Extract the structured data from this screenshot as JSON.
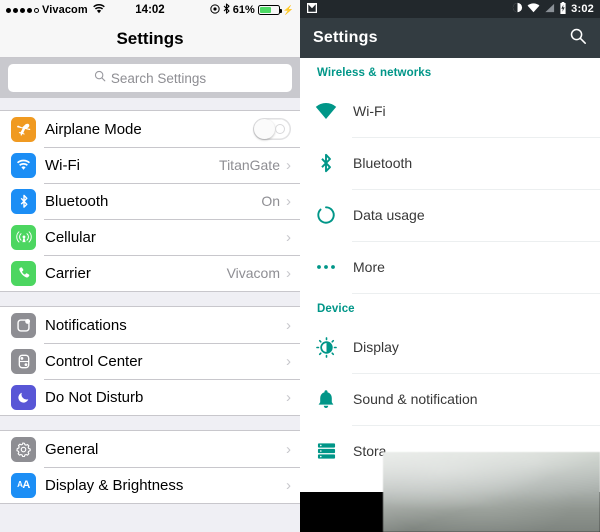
{
  "ios": {
    "status": {
      "carrier": "Vivacom",
      "signal_dots_filled": 4,
      "signal_dots_hollow": 1,
      "wifi_icon": "wifi-icon",
      "time": "14:02",
      "location_icon": "location-icon",
      "bluetooth_icon": "bluetooth-icon",
      "battery_percent": "61%",
      "battery_fill_pct": 61,
      "battery_color": "#4cd964",
      "charging_icon": "charging-bolt-icon"
    },
    "navbar": {
      "title": "Settings"
    },
    "search": {
      "placeholder": "Search Settings",
      "icon": "search-icon"
    },
    "groups": [
      {
        "rows": [
          {
            "label": "Airplane Mode",
            "icon": "airplane-icon",
            "icon_color": "#f09a21",
            "control": "toggle",
            "toggle_on": false
          },
          {
            "label": "Wi-Fi",
            "icon": "wifi-icon",
            "icon_color": "#1c8ef5",
            "value": "TitanGate",
            "control": "chevron"
          },
          {
            "label": "Bluetooth",
            "icon": "bluetooth-icon",
            "icon_color": "#1c8ef5",
            "value": "On",
            "control": "chevron"
          },
          {
            "label": "Cellular",
            "icon": "cellular-icon",
            "icon_color": "#4cd660",
            "value": "",
            "control": "chevron"
          },
          {
            "label": "Carrier",
            "icon": "phone-icon",
            "icon_color": "#4cd660",
            "value": "Vivacom",
            "control": "chevron"
          }
        ]
      },
      {
        "rows": [
          {
            "label": "Notifications",
            "icon": "notifications-icon",
            "icon_color": "#8e8e93",
            "value": "",
            "control": "chevron"
          },
          {
            "label": "Control Center",
            "icon": "control-center-icon",
            "icon_color": "#8e8e93",
            "value": "",
            "control": "chevron"
          },
          {
            "label": "Do Not Disturb",
            "icon": "moon-icon",
            "icon_color": "#5856d6",
            "value": "",
            "control": "chevron"
          }
        ]
      },
      {
        "rows": [
          {
            "label": "General",
            "icon": "gear-icon",
            "icon_color": "#8e8e93",
            "value": "",
            "control": "chevron"
          },
          {
            "label": "Display & Brightness",
            "icon": "text-size-icon",
            "icon_color": "#1c8ef5",
            "value": "",
            "control": "chevron"
          }
        ]
      }
    ]
  },
  "android": {
    "status": {
      "app_icon": "inbox-icon",
      "dnd_icon": "do-not-disturb-icon",
      "wifi_icon": "wifi-icon",
      "signal_icon": "signal-icon",
      "battery_icon": "battery-icon",
      "time": "3:02"
    },
    "appbar": {
      "title": "Settings",
      "search_icon": "search-icon"
    },
    "accent_color": "#009688",
    "sections": [
      {
        "header": "Wireless & networks",
        "rows": [
          {
            "label": "Wi-Fi",
            "icon": "wifi-icon"
          },
          {
            "label": "Bluetooth",
            "icon": "bluetooth-icon"
          },
          {
            "label": "Data usage",
            "icon": "data-usage-icon"
          },
          {
            "label": "More",
            "icon": "more-icon"
          }
        ]
      },
      {
        "header": "Device",
        "rows": [
          {
            "label": "Display",
            "icon": "brightness-icon"
          },
          {
            "label": "Sound & notification",
            "icon": "bell-icon"
          },
          {
            "label": "Stora",
            "icon": "storage-icon"
          }
        ]
      }
    ],
    "navbar": {
      "back_icon": "back-triangle-icon"
    }
  }
}
